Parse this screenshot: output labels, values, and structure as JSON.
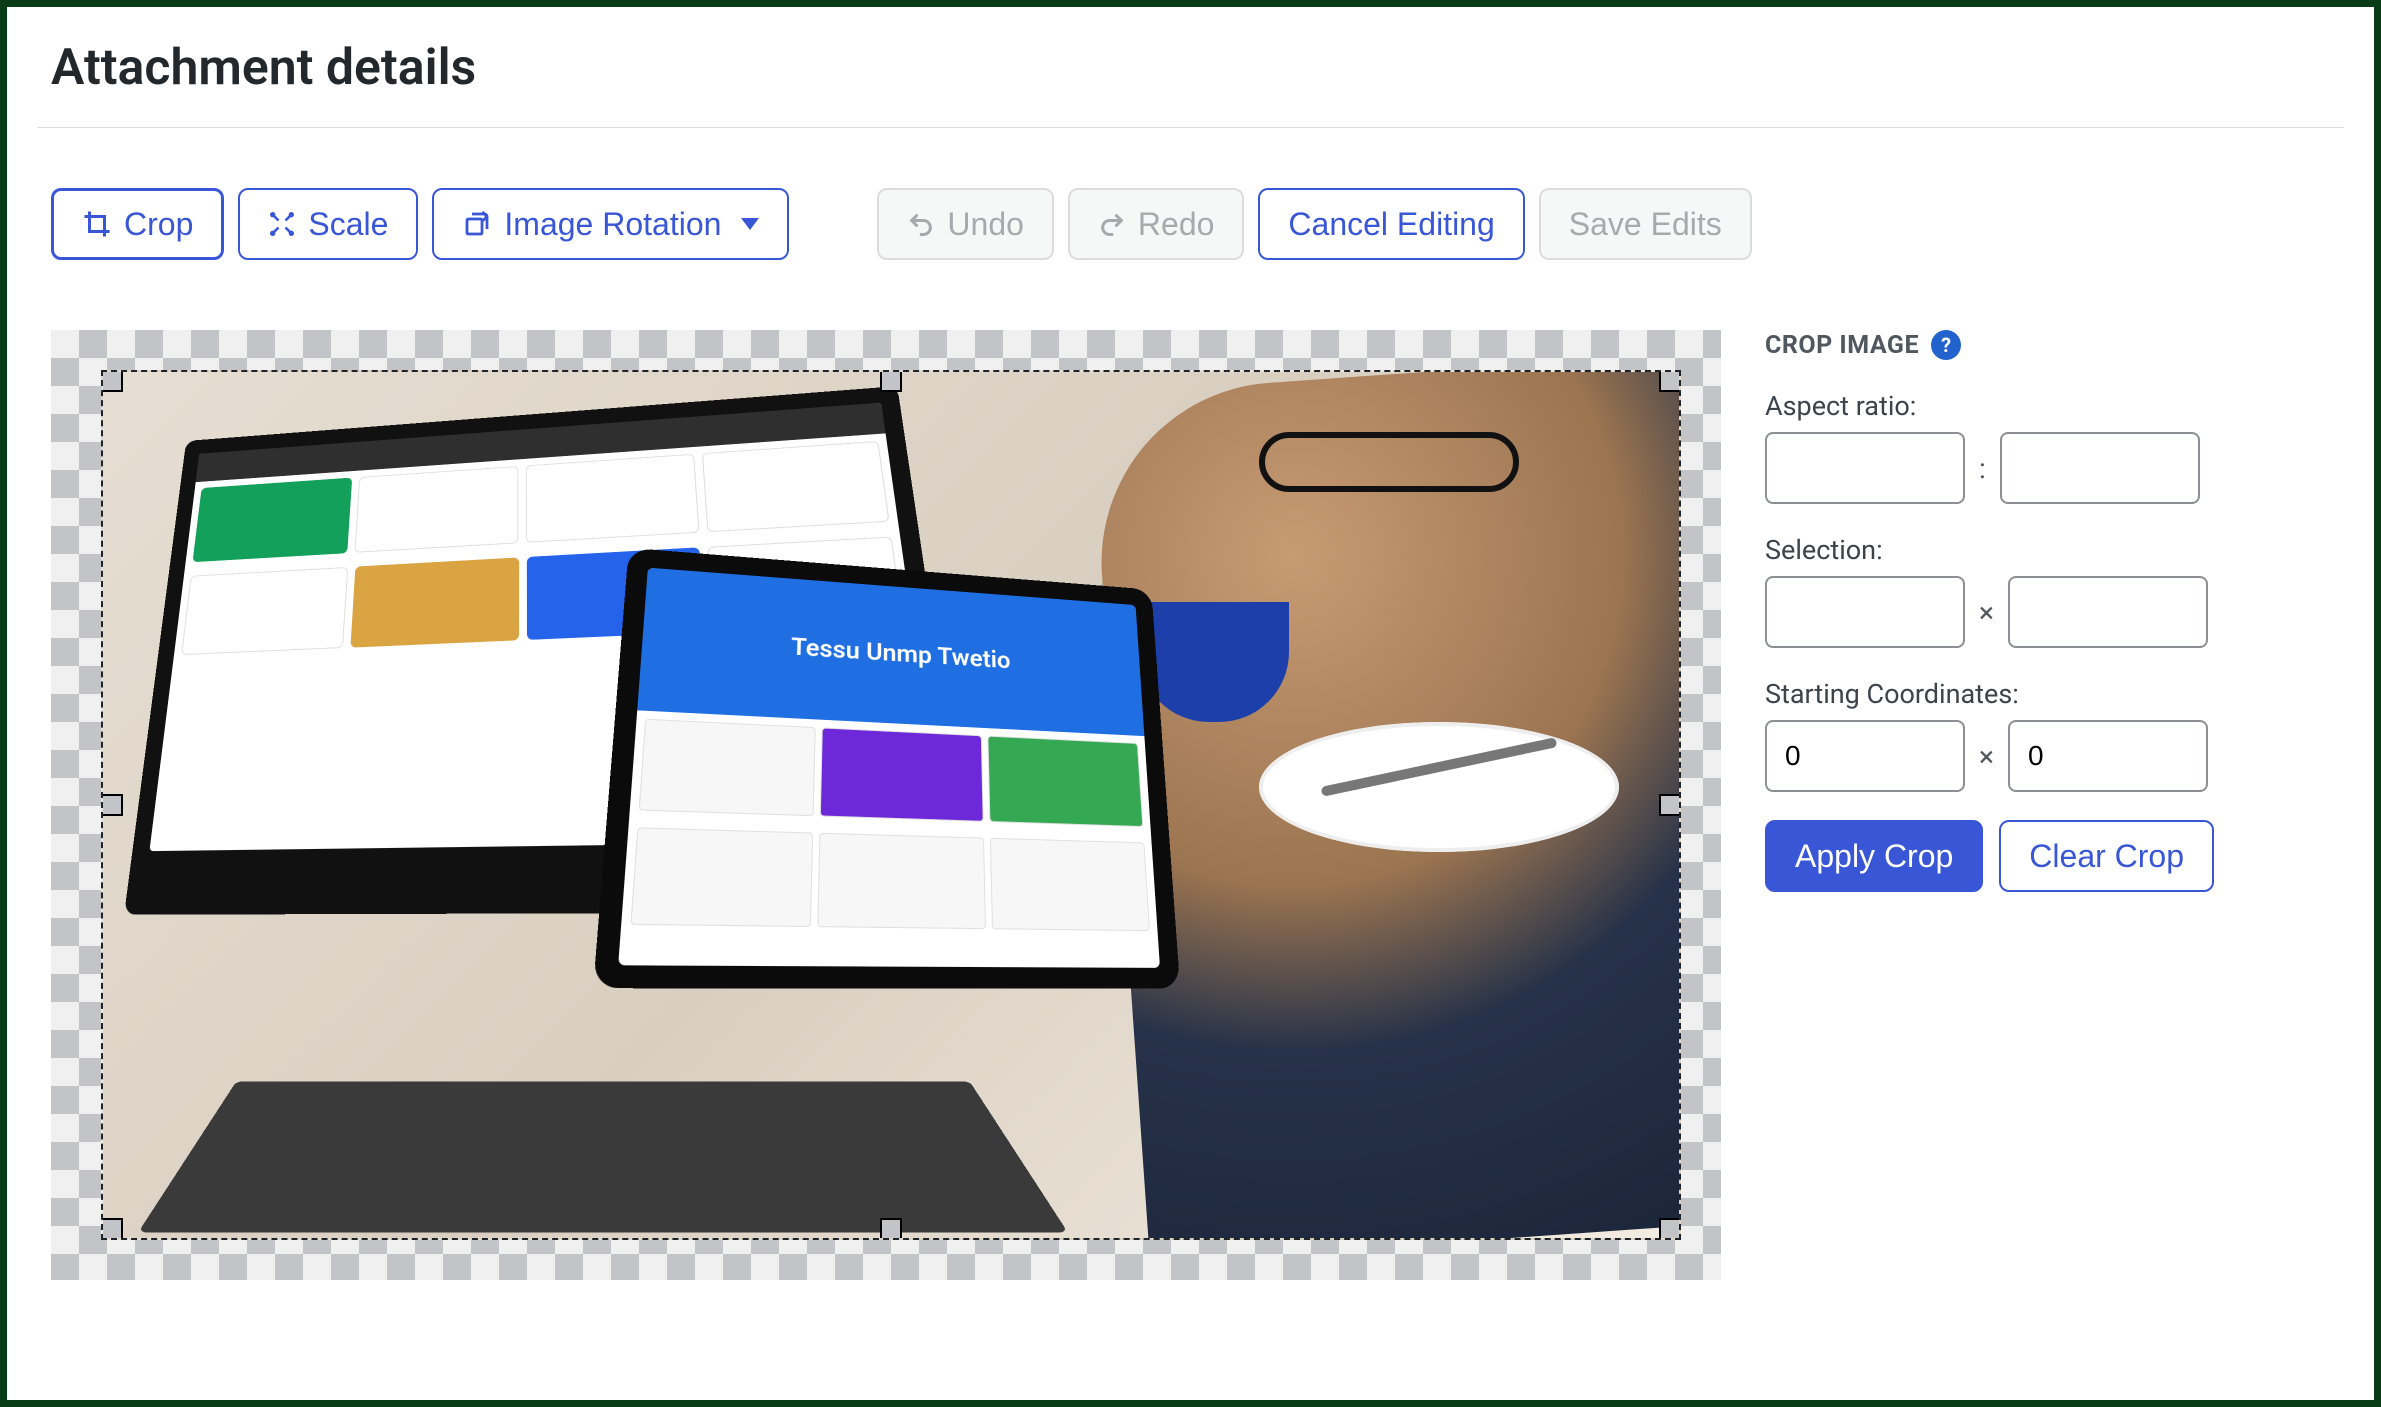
{
  "header": {
    "title": "Attachment details"
  },
  "toolbar": {
    "crop_label": "Crop",
    "scale_label": "Scale",
    "rotation_label": "Image Rotation",
    "undo_label": "Undo",
    "redo_label": "Redo",
    "cancel_label": "Cancel Editing",
    "save_label": "Save Edits"
  },
  "sidebar": {
    "title": "CROP IMAGE",
    "aspect_label": "Aspect ratio:",
    "aspect_w": "",
    "aspect_h": "",
    "aspect_sep": ":",
    "selection_label": "Selection:",
    "selection_w": "",
    "selection_h": "",
    "selection_sep": "×",
    "coords_label": "Starting Coordinates:",
    "coords_x": "0",
    "coords_y": "0",
    "coords_sep": "×",
    "apply_label": "Apply Crop",
    "clear_label": "Clear Crop"
  }
}
